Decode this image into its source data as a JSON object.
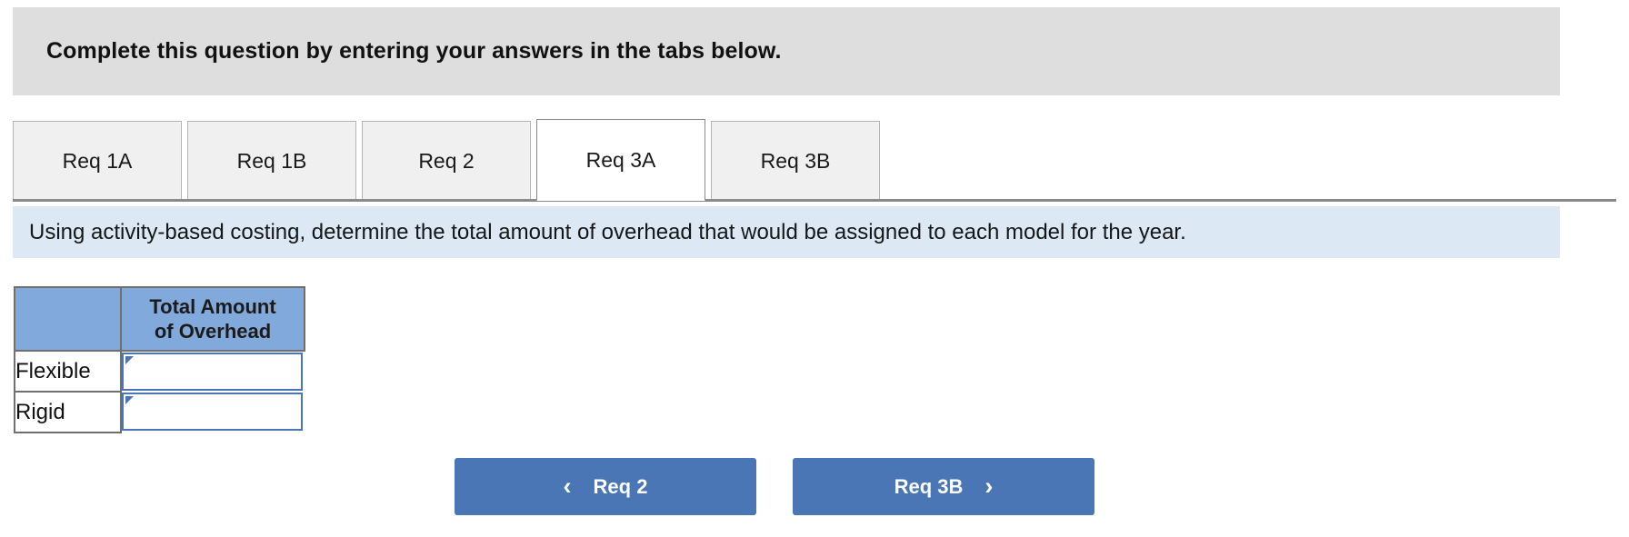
{
  "header": {
    "title": "Complete this question by entering your answers in the tabs below."
  },
  "tabs": {
    "items": [
      {
        "label": "Req 1A",
        "active": false
      },
      {
        "label": "Req 1B",
        "active": false
      },
      {
        "label": "Req 2",
        "active": false
      },
      {
        "label": "Req 3A",
        "active": true
      },
      {
        "label": "Req 3B",
        "active": false
      }
    ]
  },
  "instruction": {
    "text": "Using activity-based costing, determine the total amount of overhead that would be assigned to each model for the year."
  },
  "answer_table": {
    "header": {
      "blank": "",
      "amount_line1": "Total Amount",
      "amount_line2": "of Overhead"
    },
    "rows": [
      {
        "label": "Flexible",
        "value": ""
      },
      {
        "label": "Rigid",
        "value": ""
      }
    ]
  },
  "nav": {
    "prev_label": "Req 2",
    "prev_icon": "chevron-left-icon",
    "next_label": "Req 3B",
    "next_icon": "chevron-right-icon",
    "prev_chevron": "‹",
    "next_chevron": "›"
  },
  "colors": {
    "header_gray": "#dededf",
    "banner_blue": "#dde8f5",
    "table_header_blue": "#81a9dc",
    "button_blue": "#4a76b5",
    "input_border_blue": "#4a76b5",
    "tab_inactive": "#f0f0f0"
  }
}
